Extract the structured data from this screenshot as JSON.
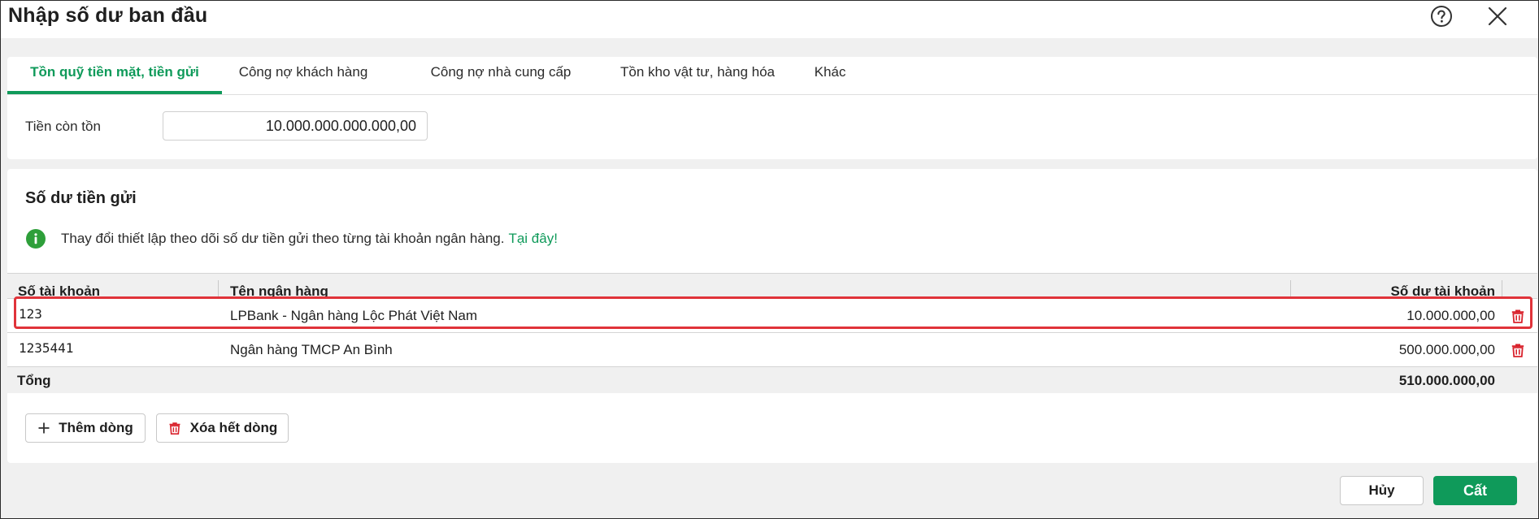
{
  "dialog": {
    "title": "Nhập số dư ban đầu",
    "help_icon": "question-circle-icon",
    "close_icon": "close-icon"
  },
  "tabs": [
    {
      "label": "Tồn quỹ tiền mặt, tiền gửi",
      "active": true
    },
    {
      "label": "Công nợ khách hàng",
      "active": false
    },
    {
      "label": "Công nợ nhà cung cấp",
      "active": false
    },
    {
      "label": "Tồn kho vật tư, hàng hóa",
      "active": false
    },
    {
      "label": "Khác",
      "active": false
    }
  ],
  "cash": {
    "label": "Tiền còn tồn",
    "value": "10.000.000.000.000,00"
  },
  "deposits": {
    "title": "Số dư tiền gửi",
    "info_text": "Thay đổi thiết lập theo dõi số dư tiền gửi theo từng tài khoản ngân hàng.",
    "info_link": "Tại đây!",
    "columns": {
      "account": "Số tài khoản",
      "bank": "Tên ngân hàng",
      "balance": "Số dư tài khoản"
    },
    "rows": [
      {
        "account": "123",
        "bank": "LPBank - Ngân hàng Lộc Phát Việt Nam",
        "balance": "10.000.000,00",
        "highlighted": true
      },
      {
        "account": "1235441",
        "bank": "Ngân hàng TMCP An Bình",
        "balance": "500.000.000,00",
        "highlighted": false
      }
    ],
    "total_label": "Tổng",
    "total_value": "510.000.000,00",
    "add_row_label": "Thêm dòng",
    "clear_rows_label": "Xóa hết dòng"
  },
  "footer": {
    "cancel_label": "Hủy",
    "save_label": "Cất"
  },
  "colors": {
    "accent": "#0f9a5a",
    "delete": "#d9232d",
    "highlight": "#e0333a"
  }
}
